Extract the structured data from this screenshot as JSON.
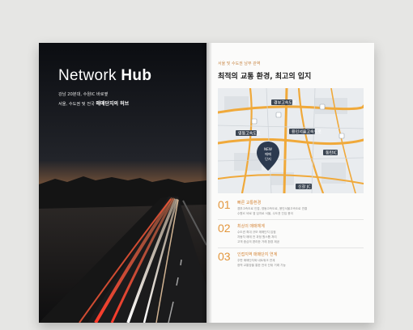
{
  "left_page": {
    "title_light": "Network",
    "title_bold": "Hub",
    "subtitle_line1": "강남 20분대, 수원IC 바로옆",
    "subtitle_line2_prefix": "서울, 수도권 및 전국",
    "subtitle_line2_strong": "매매단지의 허브"
  },
  "right_page": {
    "kicker": "서울 및 수도권 남부 관역",
    "title": "최적의 교통 환경, 최고의 입지",
    "map": {
      "road_labels": [
        "경부고속도로",
        "영동고속도로",
        "용인서울고속도로",
        "동탄IC",
        "신갈 JC"
      ],
      "pin_label_lines": [
        "NEW",
        "매매",
        "단지"
      ],
      "colors": {
        "road": "#f0a93a",
        "badge": "#3b4552",
        "pin": "#2c3a4f",
        "map_bg": "#e9ecef"
      }
    },
    "items": [
      {
        "num": "01",
        "title": "빠른 교통환경",
        "lines": [
          "경부고속도로 인접, 영동고속도로, 용인서울고속도로 연결",
          "수원IC 바로 옆 입지로 서울, 수도권 진입 용이"
        ]
      },
      {
        "num": "02",
        "title": "최상의 매매체계",
        "lines": [
          "수도권 최대 규모 매매단지 입점",
          "자동차 매매 전 과정 원스톱 처리",
          "고객 중심의 편리한 거래 환경 제공"
        ]
      },
      {
        "num": "03",
        "title": "인접지역 매매단지 연계",
        "lines": [
          "주변 매매단지와 네트워크 연계",
          "광역 교통망을 통한 전국 단위 거래 가능"
        ]
      }
    ]
  }
}
